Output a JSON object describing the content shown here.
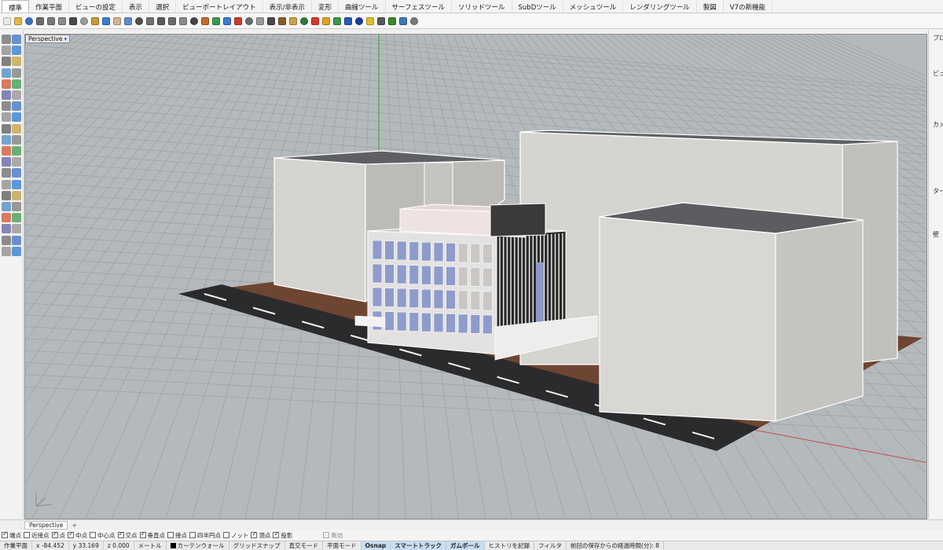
{
  "menu": {
    "tabs": [
      "標準",
      "作業平面",
      "ビューの設定",
      "表示",
      "選択",
      "ビューポートレイアウト",
      "表示/非表示",
      "変形",
      "曲線ツール",
      "サーフェスツール",
      "ソリッドツール",
      "SubDツール",
      "メッシュツール",
      "レンダリングツール",
      "製図",
      "V7の新機能"
    ],
    "active_index": 0
  },
  "toolbar": {
    "icons": [
      {
        "name": "new-file-icon",
        "color": "#e9e9e9"
      },
      {
        "name": "open-file-icon",
        "color": "#e2b74a"
      },
      {
        "name": "save-icon",
        "color": "#3f6fbf"
      },
      {
        "name": "print-icon",
        "color": "#6b6b6b"
      },
      {
        "name": "import-icon",
        "color": "#7a7a7a"
      },
      {
        "name": "export-icon",
        "color": "#8a8a8a"
      },
      {
        "name": "cut-icon",
        "color": "#4a4a4a"
      },
      {
        "name": "copy-icon",
        "color": "#9a9a9a"
      },
      {
        "name": "paste-icon",
        "color": "#c59a3a"
      },
      {
        "name": "undo-icon",
        "color": "#3e7ad1"
      },
      {
        "name": "pan-icon",
        "color": "#d7b48a"
      },
      {
        "name": "rotate-view-icon",
        "color": "#5d8ccf"
      },
      {
        "name": "zoom-icon",
        "color": "#505050"
      },
      {
        "name": "zoom-window-icon",
        "color": "#707070"
      },
      {
        "name": "zoom-extents-icon",
        "color": "#5a5a5a"
      },
      {
        "name": "zoom-selected-icon",
        "color": "#6b6b6b"
      },
      {
        "name": "undo-view-icon",
        "color": "#8a8a8a"
      },
      {
        "name": "four-viewports-icon",
        "color": "#444444"
      },
      {
        "name": "set-view-icon",
        "color": "#c96a2b"
      },
      {
        "name": "named-view-icon",
        "color": "#3a9a52"
      },
      {
        "name": "set-cplane-icon",
        "color": "#3a7bd0"
      },
      {
        "name": "car-icon",
        "color": "#d03a2a"
      },
      {
        "name": "wireframe-icon",
        "color": "#6a6a6a"
      },
      {
        "name": "ghosted-icon",
        "color": "#9a9a9a"
      },
      {
        "name": "select-icon",
        "color": "#4a4a4a"
      },
      {
        "name": "hide-icon",
        "color": "#8a5a2a"
      },
      {
        "name": "lock-icon",
        "color": "#c9a24a"
      },
      {
        "name": "object-properties-icon",
        "color": "#2a7a3a"
      },
      {
        "name": "layer-icon",
        "color": "#d93a2a"
      },
      {
        "name": "material-icon",
        "color": "#e0a020"
      },
      {
        "name": "render-icon",
        "color": "#3a9a4a"
      },
      {
        "name": "light-icon",
        "color": "#2a5ab0"
      },
      {
        "name": "sphere-icon",
        "color": "#1a3a9a"
      },
      {
        "name": "options-icon",
        "color": "#d9c030"
      },
      {
        "name": "gear-icon",
        "color": "#5a5a5a"
      },
      {
        "name": "grasshopper-icon",
        "color": "#3a8a2a"
      },
      {
        "name": "earth-icon",
        "color": "#3a7ab0"
      },
      {
        "name": "help-icon",
        "color": "#7a7a7a"
      }
    ]
  },
  "viewport": {
    "label": "Perspective",
    "arrow": "▾"
  },
  "right_panel": {
    "labels": [
      "プロ",
      "ビュ",
      "カメ",
      "ター",
      "壁"
    ]
  },
  "viewport_tabs": {
    "tabs": [
      "Perspective"
    ],
    "add": "+"
  },
  "osnap": [
    {
      "label": "端点",
      "checked": true
    },
    {
      "label": "近接点",
      "checked": false
    },
    {
      "label": "点",
      "checked": true
    },
    {
      "label": "中点",
      "checked": true
    },
    {
      "label": "中心点",
      "checked": false
    },
    {
      "label": "交点",
      "checked": true
    },
    {
      "label": "垂直点",
      "checked": true
    },
    {
      "label": "接点",
      "checked": false
    },
    {
      "label": "四半円点",
      "checked": false
    },
    {
      "label": "ノット",
      "checked": false
    },
    {
      "label": "頂点",
      "checked": true
    },
    {
      "label": "投影",
      "checked": true
    }
  ],
  "osnap_disable": {
    "label": "無効"
  },
  "status": {
    "cplane": "作業平面",
    "x": "x -84.452",
    "y": "y 33.169",
    "z": "z 0.000",
    "units": "メートル",
    "layer": "カーテンウォール",
    "grid_snap": "グリッドスナップ",
    "ortho": "直交モード",
    "planar": "平面モード",
    "osnap": "Osnap",
    "smart_track": "スマートトラック",
    "gumball": "ガムボール",
    "history": "ヒストリを記録",
    "filter": "フィルタ",
    "autosave": "前回の保存からの経過時間(分): 8"
  }
}
